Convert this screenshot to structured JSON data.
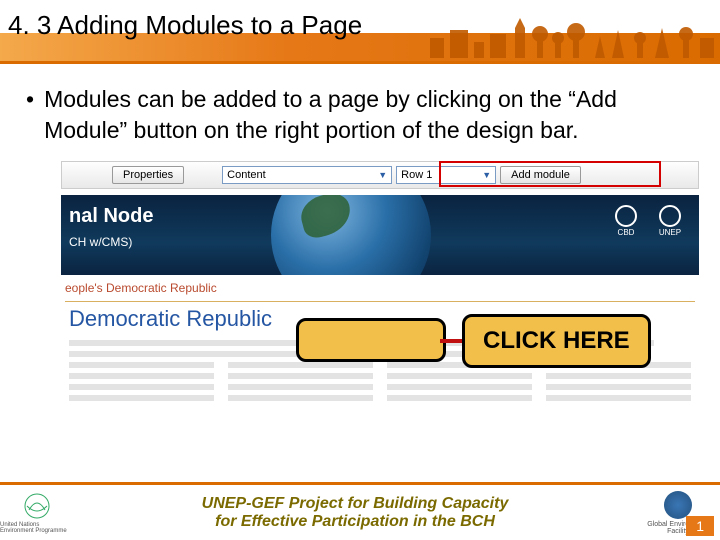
{
  "header": {
    "section_title": "4. 3 Adding Modules to a Page"
  },
  "bullet": {
    "text": "Modules can be added to a page by clicking on the “Add Module” button on the right portion of the design bar."
  },
  "toolbar": {
    "properties_btn": "Properties",
    "content_select": "Content",
    "row_select": "Row 1",
    "add_module_btn": "Add module"
  },
  "banner": {
    "title_fragment": "nal Node",
    "subtitle_fragment": "CH w/CMS)",
    "logo1": "CBD",
    "logo2": "UNEP"
  },
  "breadcrumb": "eople's Democratic Republic",
  "page_heading": "Democratic Republic",
  "callout": {
    "label": "CLICK HERE"
  },
  "footer": {
    "left_caption": "United Nations Environment Programme",
    "mid_line1": "UNEP-GEF Project for Building Capacity",
    "mid_line2": "for Effective Participation in the BCH",
    "right_caption": "Global Environment Facility"
  },
  "page_number": "1"
}
